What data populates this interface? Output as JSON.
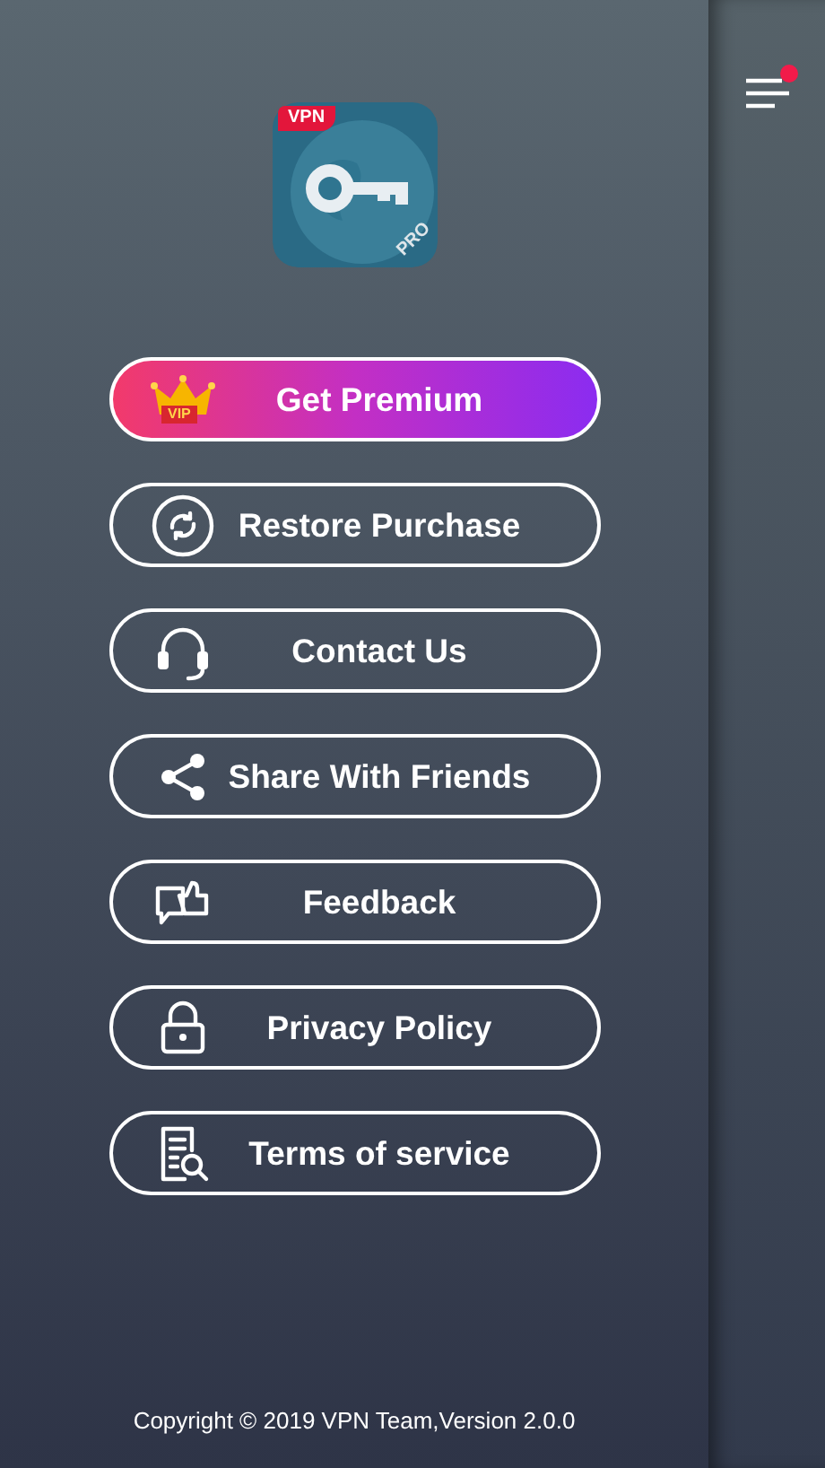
{
  "app_logo": {
    "badge": "VPN",
    "tag": "PRO"
  },
  "menu_items": [
    {
      "kind": "premium",
      "label": "Get Premium",
      "icon_text": "VIP"
    },
    {
      "kind": "restore",
      "label": "Restore Purchase"
    },
    {
      "kind": "contact",
      "label": "Contact Us"
    },
    {
      "kind": "share",
      "label": "Share With Friends"
    },
    {
      "kind": "feedback",
      "label": "Feedback"
    },
    {
      "kind": "privacy",
      "label": "Privacy Policy"
    },
    {
      "kind": "terms",
      "label": "Terms of service"
    }
  ],
  "footer": "Copyright © 2019 VPN Team,Version 2.0.0",
  "menu_button": {
    "notification": true
  }
}
